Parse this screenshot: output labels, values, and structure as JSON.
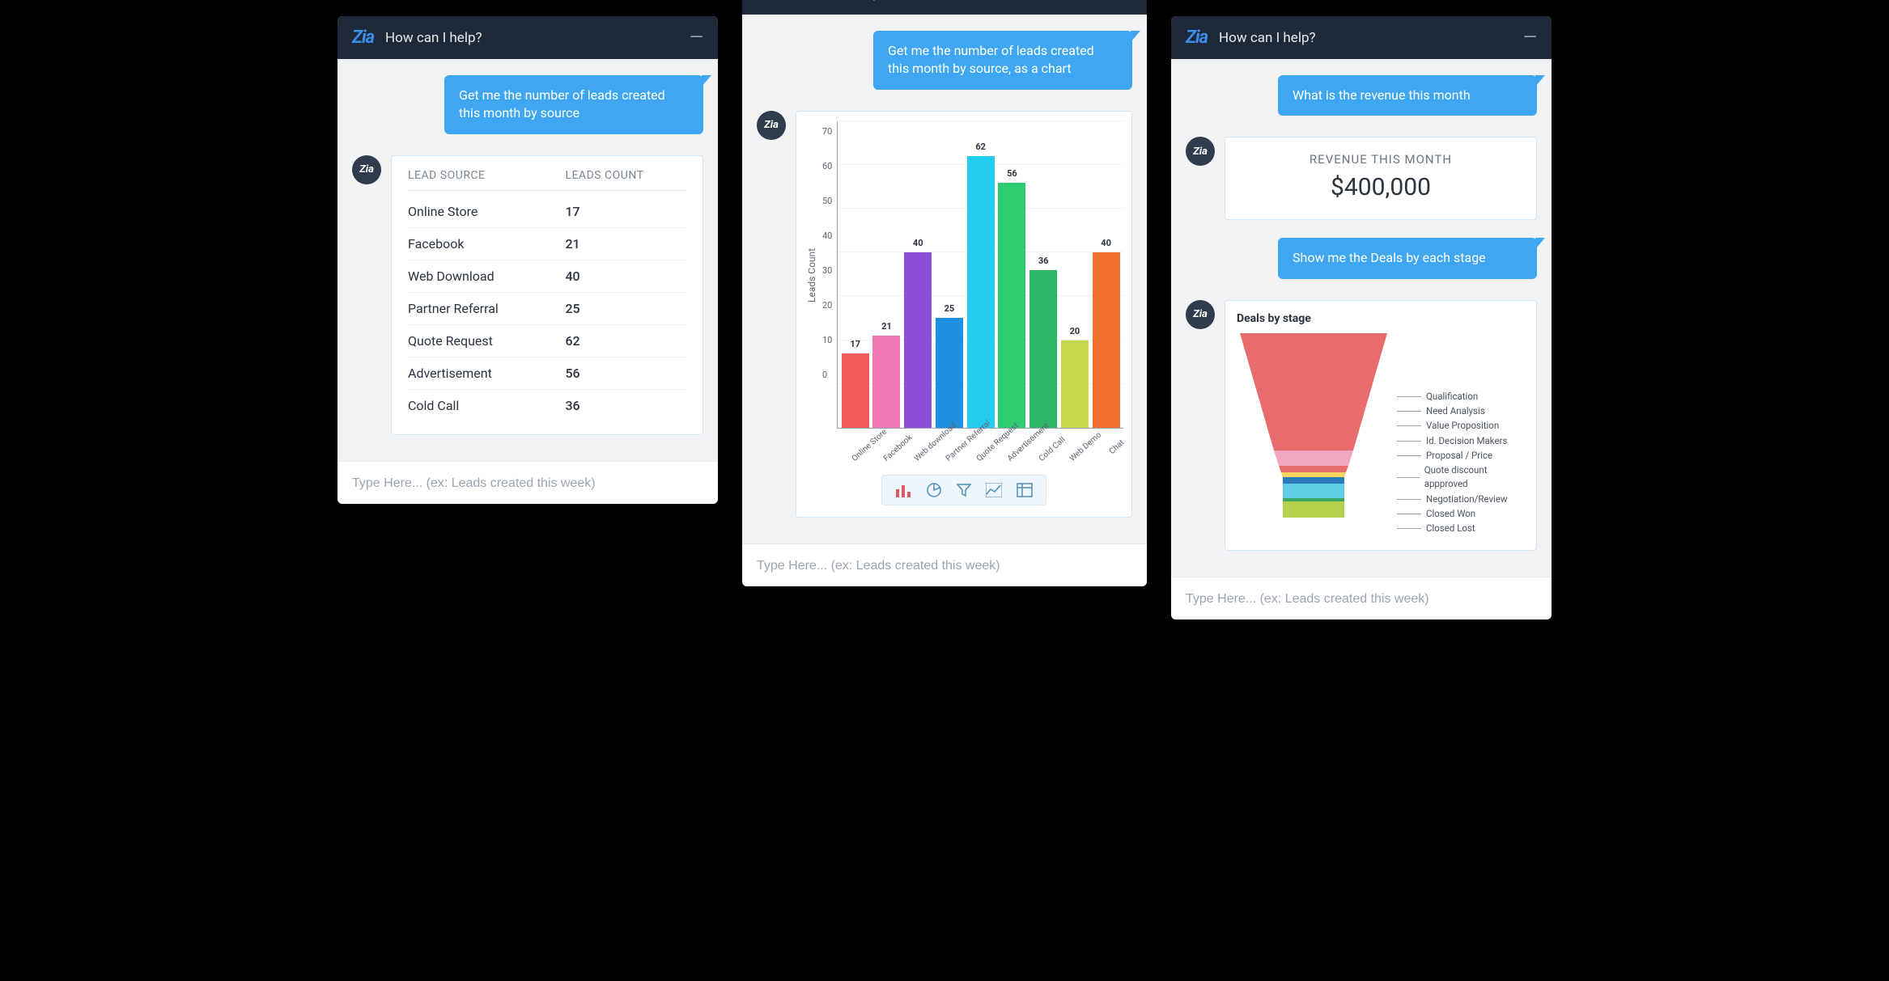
{
  "header": {
    "title": "How can I help?"
  },
  "input": {
    "placeholder": "Type Here... (ex: Leads created this week)"
  },
  "panel1": {
    "user_msg": "Get me the number of leads created this month by source",
    "table": {
      "col1": "LEAD SOURCE",
      "col2": "LEADS COUNT",
      "rows": [
        {
          "label": "Online Store",
          "value": "17"
        },
        {
          "label": "Facebook",
          "value": "21"
        },
        {
          "label": "Web Download",
          "value": "40"
        },
        {
          "label": "Partner Referral",
          "value": "25"
        },
        {
          "label": "Quote Request",
          "value": "62"
        },
        {
          "label": "Advertisement",
          "value": "56"
        },
        {
          "label": "Cold Call",
          "value": "36"
        }
      ]
    }
  },
  "panel2": {
    "user_msg": "Get me the number of leads created this month by source, as a chart"
  },
  "panel3": {
    "user_msg1": "What is the revenue this month",
    "revenue": {
      "title": "REVENUE THIS MONTH",
      "value": "$400,000"
    },
    "user_msg2": "Show me the Deals by each stage",
    "funnel": {
      "title": "Deals by stage",
      "stages": [
        "Qualification",
        "Need Analysis",
        "Value Proposition",
        "Id. Decision Makers",
        "Proposal / Price",
        "Quote discount appproved",
        "Negotiation/Review",
        "Closed Won",
        "Closed Lost"
      ]
    }
  },
  "chart_data": {
    "type": "bar",
    "ylabel": "Leads Count",
    "ylim": [
      0,
      70
    ],
    "yticks": [
      0,
      10,
      20,
      30,
      40,
      50,
      60,
      70
    ],
    "categories": [
      "Online Store",
      "Facebook",
      "Web download",
      "Partner Referral",
      "Quote Request",
      "Advertisement",
      "Cold Call",
      "Web Demo",
      "Chat"
    ],
    "values": [
      17,
      21,
      40,
      25,
      62,
      56,
      36,
      20,
      40
    ],
    "colors": [
      "#ef5b5b",
      "#f078b5",
      "#8a4fd6",
      "#1f8fe0",
      "#22cdf0",
      "#2ecc71",
      "#2bb765",
      "#c5d94a",
      "#f1702c"
    ]
  }
}
